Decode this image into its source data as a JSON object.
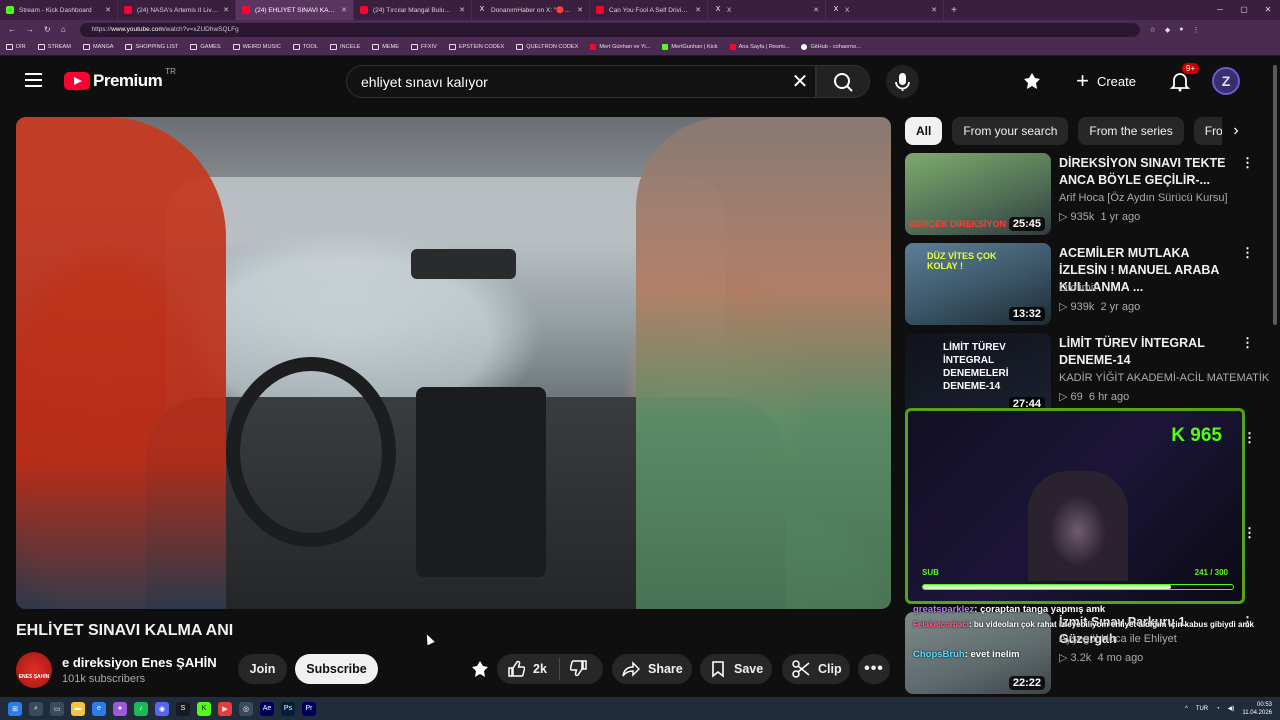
{
  "browser": {
    "tabs": [
      {
        "title": "Stream - Kick Dashboard",
        "icon": "kick-icon"
      },
      {
        "title": "(24) NASA's Artemis II Live Views f...",
        "icon": "youtube-icon"
      },
      {
        "title": "(24) EHLİYET SINAVI KALMA A...",
        "icon": "youtube-icon"
      },
      {
        "title": "(24) Tırcılar Mangal Buluşması Ver...",
        "icon": "youtube-icon"
      },
      {
        "title": "DonanımHaber on X: \"🔴 Tesla, Tü...",
        "icon": "x-icon"
      },
      {
        "title": "Can You Fool A Self Driving Car?",
        "icon": "youtube-icon"
      },
      {
        "title": "X",
        "icon": "x-icon"
      },
      {
        "title": "X",
        "icon": "x-icon"
      }
    ],
    "url_prefix": "https://",
    "url_domain": "www.youtube.com",
    "url_path": "/watch?v=xZUDhwSQLFg",
    "bookmarks": [
      "DIR",
      "STREAM",
      "MANGA",
      "SHOPPING LIST",
      "GAMES",
      "WEIRD MUSIC",
      "TOOL",
      "INCELE",
      "MEME",
      "FFXIV",
      "EPSTEIN CODEX",
      "QUELTRON CODEX",
      "Mert Günhan ve Yi...",
      "MertGunhan | Kick",
      "Ana Sayfa | Resmi...",
      "GitHub - cohaerno..."
    ]
  },
  "header": {
    "logo_text": "Premium",
    "country_code": "TR",
    "search_query": "ehliyet sınavı kalıyor",
    "create_label": "Create",
    "notif_count": "9+"
  },
  "video": {
    "title": "EHLİYET SINAVI KALMA ANI",
    "channel": "e direksiyon Enes ŞAHİN",
    "channel_avatar_text": "ENES ŞAHİN",
    "subscribers": "101k subscribers",
    "join_label": "Join",
    "subscribe_label": "Subscribe",
    "likes": "2k",
    "share_label": "Share",
    "save_label": "Save",
    "clip_label": "Clip"
  },
  "sidebar": {
    "chips": [
      "All",
      "From your search",
      "From the series",
      "Fro"
    ],
    "recs": [
      {
        "title": "DİREKSİYON SINAVI TEKTE ANCA BÖYLE GEÇİLİR-...",
        "channel": "Arif Hoca [Öz Aydın Sürücü Kursu]",
        "views": "935k",
        "age": "1 yr ago",
        "duration": "25:45",
        "thumb_text": "GERÇEK DİREKSİYON SINAVI"
      },
      {
        "title": "ACEMİLER MUTLAKA İZLESİN ! MANUEL ARABA KULLANMA ...",
        "channel": "Otolimit",
        "views": "939k",
        "age": "2 yr ago",
        "duration": "13:32",
        "thumb_text": "DÜZ VİTES ÇOK KOLAY !"
      },
      {
        "title": "LİMİT TÜREV İNTEGRAL DENEME-14",
        "channel": "KADİR YİĞİT AKADEMİ-ACİL MATEMATİK",
        "views": "69",
        "age": "6 hr ago",
        "duration": "27:44",
        "thumb_text": "LİMİT TÜREV İNTEGRAL DENEMELERİ DENEME-14"
      },
      {
        "title": "İzmit Sınav Parkuru 1. Güzergah",
        "channel": "Ayşegül Hoca ile Ehliyet",
        "views": "3.2k",
        "age": "4 mo ago",
        "duration": "22:22"
      }
    ]
  },
  "stream_overlay": {
    "counter": "K 965",
    "sub_label": "SUB",
    "sub_count": "241 / 300",
    "sub_progress": 0.8,
    "chat": [
      {
        "user": "greatsparklez",
        "msg": ": çoraptan tanga yapmış amk"
      },
      {
        "user": "Felaketcorbaci",
        "msg": ": bu videoları çok rahat izleyebiliyom ehliyet aldığım için kabus gibiydi amk"
      },
      {
        "user": "ChopsBruh",
        "msg": ": evet inelim"
      }
    ]
  },
  "taskbar": {
    "lang": "TUR",
    "time": "00:53",
    "date": "11.04.2026"
  }
}
